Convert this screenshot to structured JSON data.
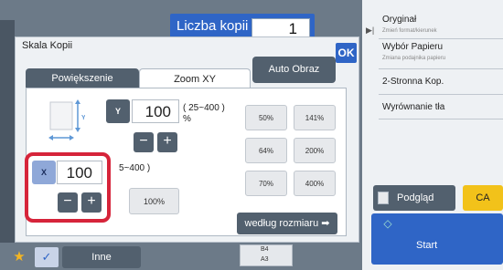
{
  "header": {
    "copies_label": "Liczba kopii",
    "copies_value": "1"
  },
  "dialog": {
    "title": "Skala Kopii",
    "ok_label": "OK",
    "tabs": [
      {
        "label": "Powiększenie",
        "active": false
      },
      {
        "label": "Zoom XY",
        "active": true
      }
    ],
    "auto_label": "Auto Obraz",
    "y": {
      "label": "Y",
      "value": "100",
      "range": "( 25~400 )",
      "unit": "%"
    },
    "x": {
      "label": "X",
      "value": "100",
      "range": "5~400 )"
    },
    "minus": "−",
    "plus": "+",
    "diagram_y": "Y",
    "preset_100": "100%",
    "presets": [
      "50%",
      "141%",
      "64%",
      "200%",
      "70%",
      "400%"
    ],
    "size_button": "według rozmiaru ➡"
  },
  "bottom": {
    "inne_label": "Inne",
    "tray_top": "B4",
    "tray_bottom": "A3"
  },
  "right_panel": {
    "items": [
      {
        "title": "Oryginał",
        "subtitle": "Zmień format/kierunek"
      },
      {
        "title": "Wybór Papieru",
        "subtitle": "Zmiana podajnika papieru"
      },
      {
        "title": "2-Stronna Kop.",
        "subtitle": ""
      },
      {
        "title": "Wyrównanie tła",
        "subtitle": ""
      }
    ],
    "preview_label": "Podgląd",
    "ca_label": "CA",
    "start_label": "Start"
  },
  "colors": {
    "accent_blue": "#2f65c6",
    "dark_button": "#52606e",
    "highlight_red": "#d6243a",
    "ca_yellow": "#f2c21a"
  }
}
